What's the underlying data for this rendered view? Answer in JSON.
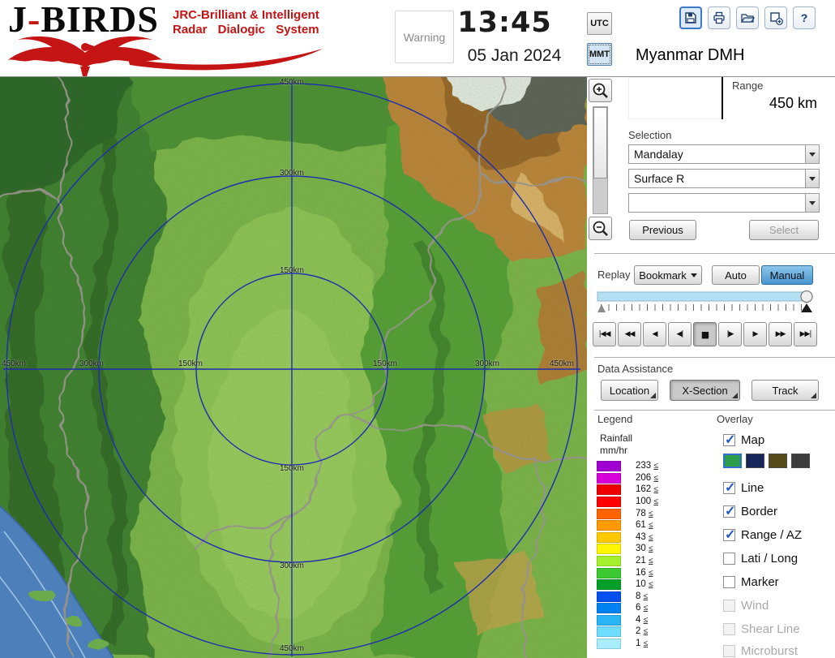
{
  "header": {
    "logo_title_j": "J",
    "logo_title_hyphen": "-",
    "logo_title_rest": "BIRDS",
    "logo_subtitle_line1": "JRC-Brilliant & Intelligent",
    "logo_subtitle_line2": "Radar Dialogic System",
    "warning_label": "Warning",
    "clock_time": "13:45",
    "clock_date": "05 Jan 2024",
    "tz_buttons": {
      "utc": "UTC",
      "mmt": "MMT",
      "selected": "MMT"
    },
    "toolbar_icons": [
      "save-icon",
      "print-icon",
      "open-folder-icon",
      "export-icon",
      "help-icon"
    ],
    "station_title": "Myanmar DMH"
  },
  "range_panel": {
    "label": "Range",
    "value": "450 km"
  },
  "selection_panel": {
    "label": "Selection",
    "dropdown_site": "Mandalay",
    "dropdown_product": "Surface R",
    "dropdown_extra": "",
    "previous_label": "Previous",
    "select_label": "Select"
  },
  "replay_panel": {
    "label": "Replay",
    "bookmark_label": "Bookmark",
    "auto_label": "Auto",
    "manual_label": "Manual",
    "selected_mode": "Manual",
    "media_buttons": [
      "|◀◀",
      "◀◀",
      "◀",
      "◀|",
      "■",
      "|▶",
      "▶",
      "▶▶",
      "▶▶|"
    ],
    "active_media_button": "■"
  },
  "data_assistance": {
    "label": "Data Assistance",
    "buttons": [
      "Location",
      "X-Section",
      "Track"
    ],
    "active_button": "X-Section"
  },
  "legend": {
    "label": "Legend",
    "unit_line1": "Rainfall",
    "unit_line2": "mm/hr",
    "suffix": "≤",
    "rows": [
      {
        "value": "233",
        "color": "#a000d0"
      },
      {
        "value": "206",
        "color": "#d800d8"
      },
      {
        "value": "162",
        "color": "#ee0000"
      },
      {
        "value": "100",
        "color": "#ff0000"
      },
      {
        "value": "78",
        "color": "#ff6400"
      },
      {
        "value": "61",
        "color": "#ff9b00"
      },
      {
        "value": "43",
        "color": "#ffc800"
      },
      {
        "value": "30",
        "color": "#fff500"
      },
      {
        "value": "21",
        "color": "#a4f02c"
      },
      {
        "value": "16",
        "color": "#3cc832"
      },
      {
        "value": "10",
        "color": "#00a028"
      },
      {
        "value": "8",
        "color": "#0050f0"
      },
      {
        "value": "6",
        "color": "#0082f0"
      },
      {
        "value": "4",
        "color": "#28b4f5"
      },
      {
        "value": "2",
        "color": "#6edcff"
      },
      {
        "value": "1",
        "color": "#a8eeff"
      }
    ]
  },
  "overlay": {
    "label": "Overlay",
    "items": [
      {
        "label": "Map",
        "checked": true,
        "disabled": false
      },
      {
        "label": "Line",
        "checked": true,
        "disabled": false
      },
      {
        "label": "Border",
        "checked": true,
        "disabled": false
      },
      {
        "label": "Range / AZ",
        "checked": true,
        "disabled": false
      },
      {
        "label": "Lati / Long",
        "checked": false,
        "disabled": false
      },
      {
        "label": "Marker",
        "checked": false,
        "disabled": false
      },
      {
        "label": "Wind",
        "checked": false,
        "disabled": true
      },
      {
        "label": "Shear Line",
        "checked": false,
        "disabled": true
      },
      {
        "label": "Microburst",
        "checked": false,
        "disabled": true
      }
    ],
    "map_styles": [
      "#2e9e4d",
      "#16265a",
      "#56491a",
      "#3c3c3c"
    ],
    "selected_map_style": 0
  },
  "map": {
    "ring_labels": [
      "450km",
      "300km",
      "150km",
      "150km",
      "300km",
      "450km",
      "450km",
      "300km",
      "150km",
      "150km",
      "300km",
      "450km"
    ]
  }
}
